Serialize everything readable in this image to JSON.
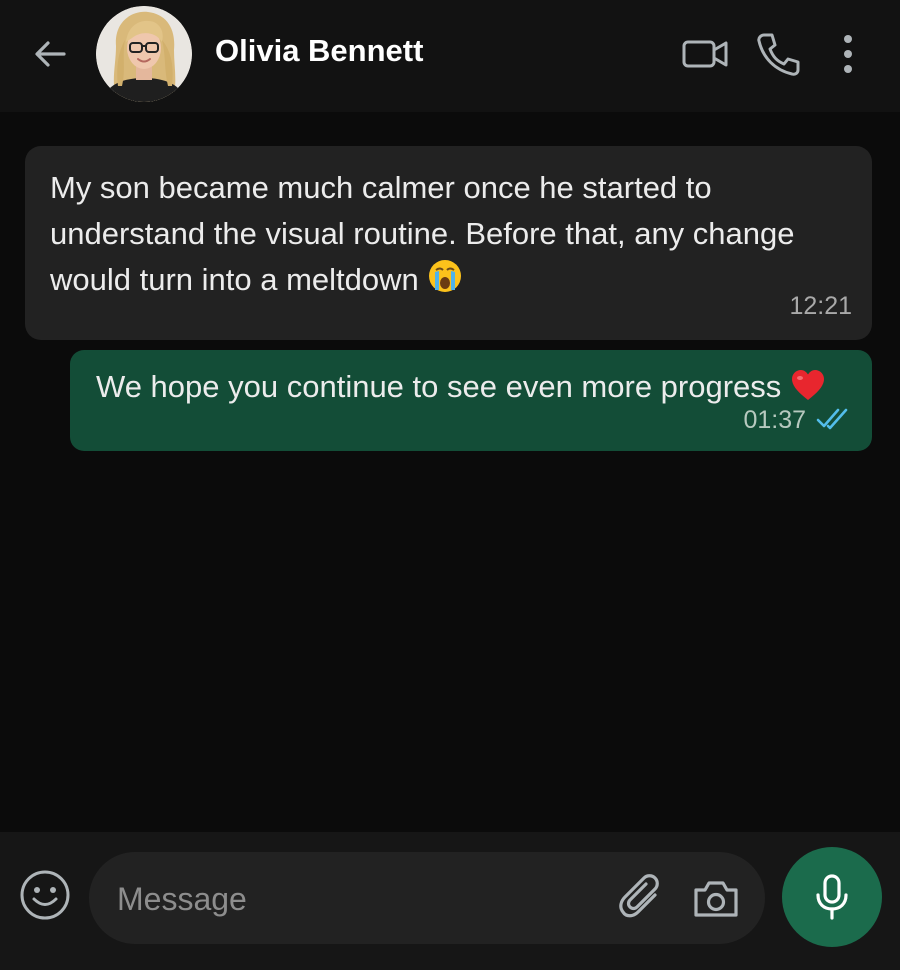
{
  "header": {
    "contact_name": "Olivia Bennett",
    "icons": [
      "back-arrow-icon",
      "avatar",
      "video-camera-icon",
      "phone-icon",
      "more-vertical-icon"
    ]
  },
  "messages": [
    {
      "direction": "incoming",
      "text": "My son became much calmer once he started to understand the visual routine. Before that, any change would turn into a meltdown",
      "emoji": "😭",
      "time": "12:21"
    },
    {
      "direction": "outgoing",
      "text": "We hope you continue to see even more progress",
      "emoji": "❤️",
      "time": "01:37",
      "status": "read"
    }
  ],
  "composer": {
    "placeholder": "Message",
    "value": "",
    "icons": [
      "emoji-icon",
      "paperclip-icon",
      "camera-icon",
      "microphone-icon"
    ]
  },
  "colors": {
    "background": "#0b0b0b",
    "header": "#121212",
    "incoming_bubble": "#222222",
    "outgoing_bubble": "#134d37",
    "mic_button": "#1b6b4c",
    "read_ticks": "#53bdeb"
  }
}
